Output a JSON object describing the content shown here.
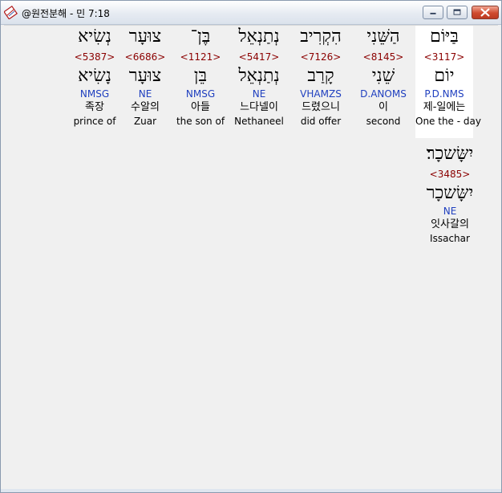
{
  "window": {
    "title": "@원전분해 - 민 7:18",
    "icons": {
      "app": "bible-book-icon",
      "minimize": "minimize-icon",
      "maximize": "maximize-icon",
      "close": "close-icon"
    }
  },
  "words": [
    {
      "hebrew": "בַּיּוֹם",
      "strong": "<3117>",
      "lemma": "יוֹם",
      "parse": "P.D.NMS",
      "korean": "제-일에는",
      "english": "One the - day",
      "selected": true
    },
    {
      "hebrew": "הַשֵּׁנִי",
      "strong": "<8145>",
      "lemma": "שֵׁנִי",
      "parse": "D.ANOMS",
      "korean": "이",
      "english": "second"
    },
    {
      "hebrew": "הִקְרִיב",
      "strong": "<7126>",
      "lemma": "קָרַב",
      "parse": "VHAMZS",
      "korean": "드렸으니",
      "english": "did offer"
    },
    {
      "hebrew": "נְתַנְאֵל",
      "strong": "<5417>",
      "lemma": "נְתַנְאֵל",
      "parse": "NE",
      "korean": "느다넬이",
      "english": "Nethaneel"
    },
    {
      "hebrew": "בֶּן־",
      "strong": "<1121>",
      "lemma": "בֵּן",
      "parse": "NMSG",
      "korean": "아들",
      "english": "the son of"
    },
    {
      "hebrew": "צוּעָר",
      "strong": "<6686>",
      "lemma": "צוּעָר",
      "parse": "NE",
      "korean": "수알의",
      "english": "Zuar"
    },
    {
      "hebrew": "נְשִׂיא",
      "strong": "<5387>",
      "lemma": "נָשִׂיא",
      "parse": "NMSG",
      "korean": "족장",
      "english": "prince of"
    },
    {
      "hebrew": "יִשָּׂשכָר׃",
      "strong": "<3485>",
      "lemma": "יִשָּׂשכָר",
      "parse": "NE",
      "korean": "잇사갈의",
      "english": "Issachar"
    }
  ]
}
